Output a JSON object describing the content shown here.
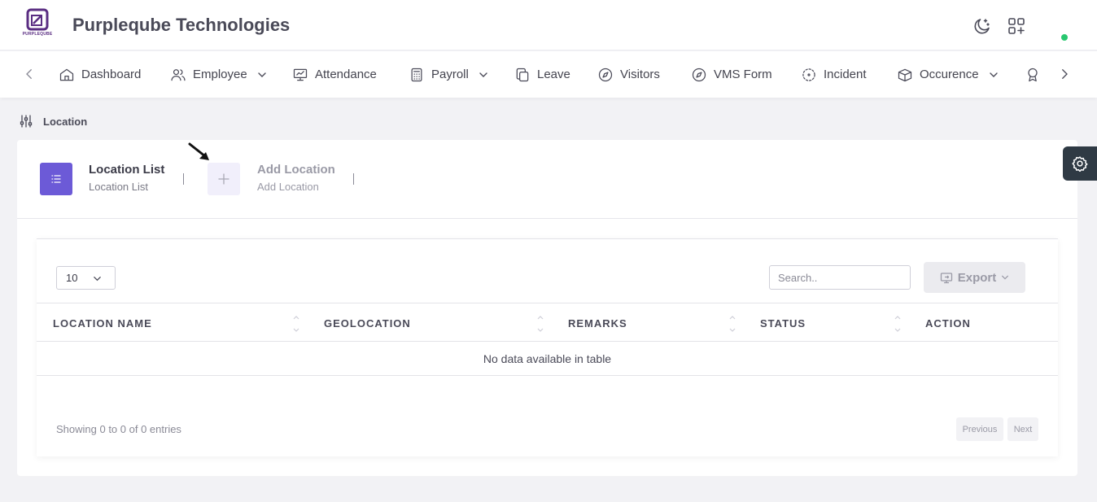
{
  "app": {
    "company_name": "Purpleqube Technologies",
    "logo_caption": "PURPLEQUBE",
    "brand_color": "#6c5ad7",
    "online_status_color": "#28c76f"
  },
  "top_actions": {
    "theme_icon": "moon-icon",
    "apps_icon": "grid-plus-icon"
  },
  "nav": {
    "items": [
      {
        "label": "Dashboard",
        "icon": "home-icon",
        "has_dropdown": false
      },
      {
        "label": "Employee",
        "icon": "users-icon",
        "has_dropdown": true
      },
      {
        "label": "Attendance",
        "icon": "presentation-icon",
        "has_dropdown": false
      },
      {
        "label": "Payroll",
        "icon": "calculator-icon",
        "has_dropdown": true
      },
      {
        "label": "Leave",
        "icon": "copy-icon",
        "has_dropdown": false
      },
      {
        "label": "Visitors",
        "icon": "compass-icon",
        "has_dropdown": false
      },
      {
        "label": "VMS Form",
        "icon": "compass-icon",
        "has_dropdown": false
      },
      {
        "label": "Incident",
        "icon": "focus-icon",
        "has_dropdown": false
      },
      {
        "label": "Occurence",
        "icon": "box-icon",
        "has_dropdown": true
      }
    ]
  },
  "page": {
    "title": "Location"
  },
  "tabs": [
    {
      "title": "Location List",
      "subtitle": "Location List",
      "active": true,
      "icon": "list-icon"
    },
    {
      "title": "Add Location",
      "subtitle": "Add Location",
      "active": false,
      "icon": "plus-icon"
    }
  ],
  "table_controls": {
    "page_length": "10",
    "search_placeholder": "Search..",
    "export_label": "Export"
  },
  "table": {
    "columns": [
      "LOCATION NAME",
      "GEOLOCATION",
      "REMARKS",
      "STATUS",
      "ACTION"
    ],
    "rows": [],
    "empty_message": "No data available in table"
  },
  "footer": {
    "info": "Showing 0 to 0 of 0 entries",
    "previous_label": "Previous",
    "next_label": "Next"
  }
}
